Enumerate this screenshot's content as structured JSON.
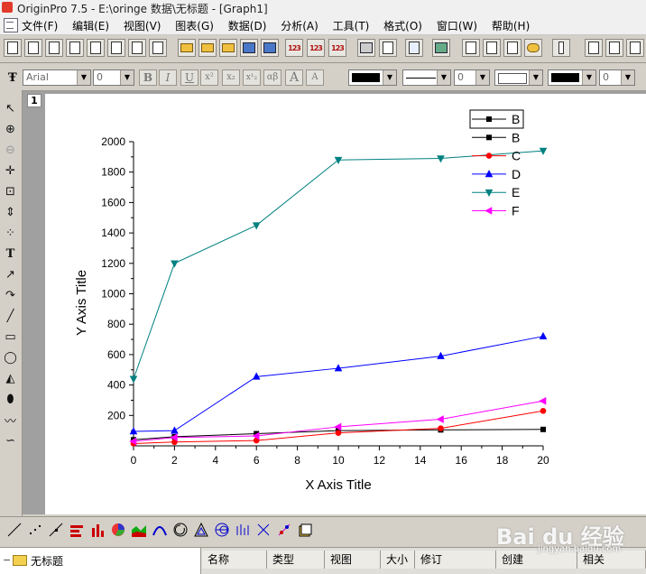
{
  "window": {
    "title": "OriginPro 7.5 - E:\\oringe 数据\\无标题 - [Graph1]"
  },
  "menu": [
    "文件(F)",
    "编辑(E)",
    "视图(V)",
    "图表(G)",
    "数据(D)",
    "分析(A)",
    "工具(T)",
    "格式(O)",
    "窗口(W)",
    "帮助(H)"
  ],
  "format_toolbar": {
    "font": "Arial",
    "font_size": "0",
    "bold": "B",
    "italic": "I",
    "underline": "U",
    "superscript": "x²",
    "subscript": "x₂",
    "supersub": "x¹₂",
    "greek": "αβ",
    "grow": "A",
    "shrink": "A",
    "line_width": "0",
    "pattern_width": "0",
    "fill_color": "#000000",
    "line_color": "#000000"
  },
  "layer": {
    "number": "1"
  },
  "chart_data": {
    "type": "line",
    "xlabel": "X Axis Title",
    "ylabel": "Y Axis Title",
    "xlim": [
      0,
      20
    ],
    "ylim": [
      0,
      2000
    ],
    "xticks": [
      0,
      2,
      4,
      6,
      8,
      10,
      12,
      14,
      16,
      18,
      20
    ],
    "yticks": [
      200,
      400,
      600,
      800,
      1000,
      1200,
      1400,
      1600,
      1800,
      2000
    ],
    "grid": false,
    "legend_position": "top-right",
    "legend": [
      {
        "name": "B",
        "color": "#000000",
        "marker": "square",
        "boxed": true
      },
      {
        "name": "B",
        "color": "#000000",
        "marker": "square"
      },
      {
        "name": "C",
        "color": "#ff0000",
        "marker": "circle"
      },
      {
        "name": "D",
        "color": "#0000ff",
        "marker": "triangle-up"
      },
      {
        "name": "E",
        "color": "#008080",
        "marker": "triangle-down"
      },
      {
        "name": "F",
        "color": "#ff00ff",
        "marker": "triangle-left"
      }
    ],
    "series": [
      {
        "name": "B",
        "color": "#000000",
        "marker": "square",
        "x": [
          0,
          2,
          6,
          10,
          15,
          20
        ],
        "y": [
          40,
          60,
          80,
          100,
          105,
          108
        ]
      },
      {
        "name": "C",
        "color": "#ff0000",
        "marker": "circle",
        "x": [
          0,
          2,
          6,
          10,
          15,
          20
        ],
        "y": [
          15,
          25,
          35,
          85,
          115,
          230
        ]
      },
      {
        "name": "D",
        "color": "#0000ff",
        "marker": "triangle-up",
        "x": [
          0,
          2,
          6,
          10,
          15,
          20
        ],
        "y": [
          95,
          100,
          455,
          510,
          590,
          720
        ]
      },
      {
        "name": "E",
        "color": "#008080",
        "marker": "triangle-down",
        "x": [
          0,
          2,
          6,
          10,
          15,
          20
        ],
        "y": [
          440,
          1200,
          1450,
          1880,
          1890,
          1940
        ]
      },
      {
        "name": "F",
        "color": "#ff00ff",
        "marker": "triangle-left",
        "x": [
          0,
          2,
          6,
          10,
          15,
          20
        ],
        "y": [
          30,
          55,
          65,
          125,
          175,
          295
        ]
      }
    ]
  },
  "project_explorer": {
    "folder": "无标题",
    "columns": [
      "名称",
      "类型",
      "视图",
      "大小",
      "修订",
      "创建",
      "相关"
    ]
  },
  "watermark": {
    "brand": "Bai du 经验",
    "sub": "jingyan.baidu.com"
  }
}
